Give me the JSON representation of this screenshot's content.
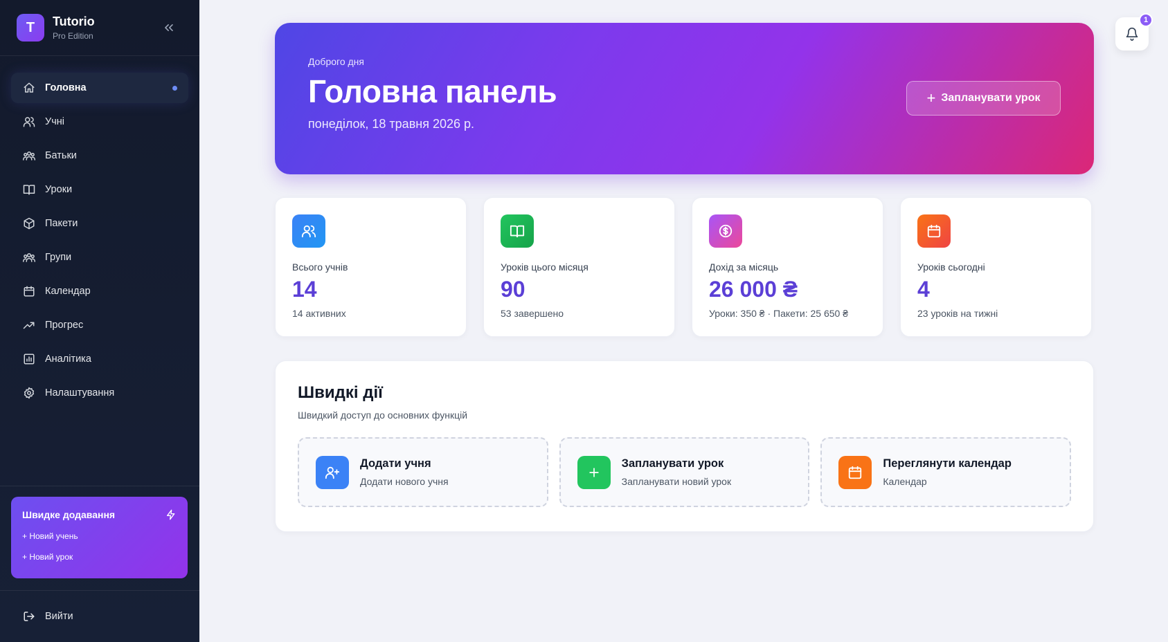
{
  "brand": {
    "logo_letter": "T",
    "name": "Tutorio",
    "edition": "Pro Edition"
  },
  "nav": {
    "items": [
      {
        "label": "Головна",
        "icon": "home-icon",
        "active": true
      },
      {
        "label": "Учні",
        "icon": "users-icon"
      },
      {
        "label": "Батьки",
        "icon": "family-icon"
      },
      {
        "label": "Уроки",
        "icon": "book-icon"
      },
      {
        "label": "Пакети",
        "icon": "package-icon"
      },
      {
        "label": "Групи",
        "icon": "groups-icon"
      },
      {
        "label": "Календар",
        "icon": "calendar-icon"
      },
      {
        "label": "Прогрес",
        "icon": "trending-up-icon"
      },
      {
        "label": "Аналітика",
        "icon": "bar-chart-icon"
      },
      {
        "label": "Налаштування",
        "icon": "gear-icon"
      }
    ]
  },
  "quick_add": {
    "title": "Швидке додавання",
    "new_student": "+ Новий учень",
    "new_lesson": "+ Новий урок"
  },
  "logout": {
    "label": "Вийти"
  },
  "notifications": {
    "count": "1"
  },
  "hero": {
    "greeting": "Доброго дня",
    "title": "Головна панель",
    "date": "понеділок, 18 травня 2026 р.",
    "button_label": "Запланувати урок"
  },
  "stats": [
    {
      "label": "Всього учнів",
      "value": "14",
      "sub": "14 активних",
      "icon": "users-icon",
      "color": "#3b82f6"
    },
    {
      "label": "Уроків цього місяця",
      "value": "90",
      "sub": "53 завершено",
      "icon": "book-icon",
      "color": "#22c55e"
    },
    {
      "label": "Дохід за місяць",
      "value": "26 000 ₴",
      "sub": "Уроки: 350 ₴ · Пакети: 25 650 ₴",
      "icon": "dollar-icon",
      "color": "#c044d8"
    },
    {
      "label": "Уроків сьогодні",
      "value": "4",
      "sub": "23 уроків на тижні",
      "icon": "calendar-icon",
      "color": "#f97316"
    }
  ],
  "quick_actions": {
    "title": "Швидкі дії",
    "subtitle": "Швидкий доступ до основних функцій",
    "items": [
      {
        "title": "Додати учня",
        "sub": "Додати нового учня",
        "icon": "user-plus-icon",
        "color": "#3b82f6"
      },
      {
        "title": "Запланувати урок",
        "sub": "Запланувати новий урок",
        "icon": "plus-icon",
        "color": "#22c55e"
      },
      {
        "title": "Переглянути календар",
        "sub": "Календар",
        "icon": "calendar-icon",
        "color": "#f97316"
      }
    ]
  },
  "colors": {
    "accent": "#5b3fd6",
    "sidebar_bg": "#131a2c"
  }
}
